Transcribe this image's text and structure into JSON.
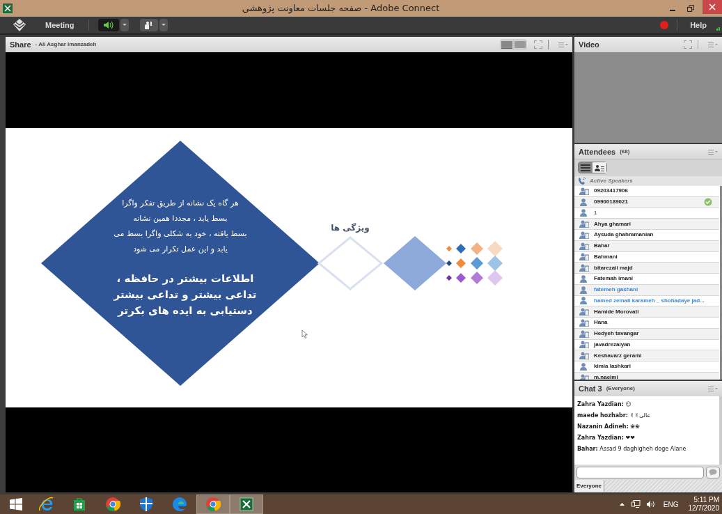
{
  "window": {
    "title": "Adobe Connect - صفحه جلسات معاونت پژوهشي"
  },
  "menu_bar": {
    "meeting": "Meeting",
    "help": "Help",
    "audio_on": true,
    "recording": true
  },
  "share_pod": {
    "title": "Share",
    "presenter": "- Ali Asghar Imanzadeh",
    "slide": {
      "heading": "ویژگی ها",
      "paragraph": "هر گاه یک نشانه از طریق تفکر واگرا\nبسط یابد ، مجددا همین نشانه\nبسط یافته ، خود به شکلی واگرا بسط می\nیابد و این عمل تکرار می شود",
      "highlight": "اطلاعات بیشتر در حافظه ،\nتداعی بیشتر و تداعی بیشتر\nدستیابی به ایده های بکرتر"
    }
  },
  "video_pod": {
    "title": "Video"
  },
  "attendees_pod": {
    "title": "Attendees",
    "count": "(68)",
    "views": [
      {
        "kind": "list",
        "selected": true
      },
      {
        "kind": "people",
        "selected": false
      }
    ],
    "active_speakers": "Active Speakers",
    "rows": [
      {
        "name": "09203417906",
        "kind": "phone",
        "color": "#222222",
        "checked": false
      },
      {
        "name": "09900189021",
        "kind": "person",
        "color": "#222222",
        "checked": true
      },
      {
        "name": "1",
        "kind": "person",
        "color": "#3a86d8",
        "checked": false
      },
      {
        "name": "Ahya ghamari",
        "kind": "phone",
        "color": "#222222",
        "checked": false
      },
      {
        "name": "Aysuda ghahramanian",
        "kind": "phone",
        "color": "#222222",
        "checked": false
      },
      {
        "name": "Bahar",
        "kind": "phone",
        "color": "#222222",
        "checked": false
      },
      {
        "name": "Bahmani",
        "kind": "phone",
        "color": "#222222",
        "checked": false
      },
      {
        "name": "bitarezaii majd",
        "kind": "phone",
        "color": "#222222",
        "checked": false
      },
      {
        "name": "Fatemah imani",
        "kind": "person",
        "color": "#222222",
        "checked": false
      },
      {
        "name": "fatemeh gashani",
        "kind": "person",
        "color": "#3a86d8",
        "checked": false
      },
      {
        "name": "hamed zeinali karameh _ shohadaye jad...",
        "kind": "person",
        "color": "#3a86d8",
        "checked": false
      },
      {
        "name": "Hamide Morovati",
        "kind": "phone",
        "color": "#222222",
        "checked": false
      },
      {
        "name": "Hana",
        "kind": "phone",
        "color": "#222222",
        "checked": false
      },
      {
        "name": "Hedyeh tavangar",
        "kind": "phone",
        "color": "#222222",
        "checked": false
      },
      {
        "name": "javadrezaiyan",
        "kind": "phone",
        "color": "#222222",
        "checked": false
      },
      {
        "name": "Keshavarz gerami",
        "kind": "phone",
        "color": "#222222",
        "checked": false
      },
      {
        "name": "kimia lashkari",
        "kind": "person",
        "color": "#222222",
        "checked": false
      },
      {
        "name": "m.naeimi",
        "kind": "phone",
        "color": "#222222",
        "checked": false
      }
    ]
  },
  "chat_pod": {
    "title": "Chat 3",
    "audience": "(Everyone)",
    "messages": [
      {
        "sender": "Zahra Yazdian:",
        "text": "☺"
      },
      {
        "sender": "maede hozhabr:",
        "text": "✌✌عالی"
      },
      {
        "sender": "Nazanin Adineh:",
        "text": "❀❀"
      },
      {
        "sender": "Zahra Yazdian:",
        "text": "❤❤"
      },
      {
        "sender": "Bahar:",
        "text": "Assad 9 daghigheh doge Alane"
      }
    ],
    "tabs": [
      {
        "label": "Everyone",
        "selected": true
      }
    ]
  },
  "taskbar": {
    "apps": [
      {
        "kind": "ie",
        "active": false
      },
      {
        "kind": "store",
        "active": false
      },
      {
        "kind": "chrome",
        "active": false
      },
      {
        "kind": "shield",
        "active": false
      },
      {
        "kind": "edge",
        "active": false
      },
      {
        "kind": "chrome",
        "active": true
      },
      {
        "kind": "connect",
        "active": true
      }
    ],
    "language": "ENG",
    "time": "5:11 PM",
    "date": "12/7/2020"
  }
}
